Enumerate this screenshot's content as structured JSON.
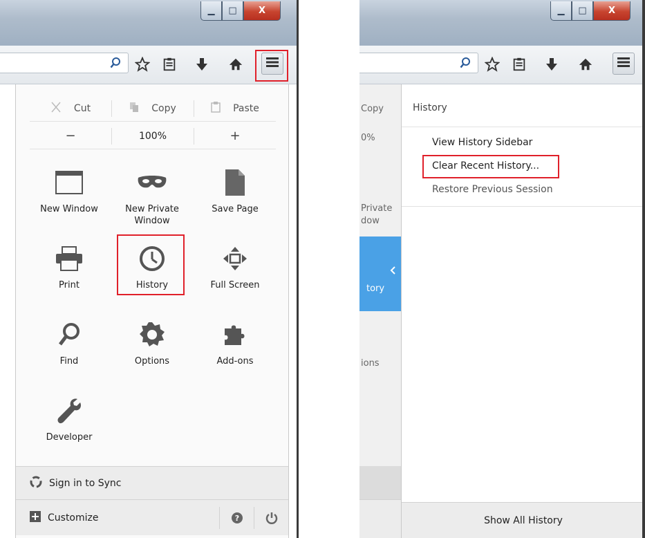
{
  "left_pane": {
    "edit": {
      "cut": "Cut",
      "copy": "Copy",
      "paste": "Paste"
    },
    "zoom": {
      "minus": "−",
      "level": "100%",
      "plus": "+"
    },
    "items": [
      {
        "label": "New Window",
        "icon": "window-icon"
      },
      {
        "label": "New Private\nWindow",
        "icon": "mask-icon"
      },
      {
        "label": "Save Page",
        "icon": "page-icon"
      },
      {
        "label": "Print",
        "icon": "printer-icon"
      },
      {
        "label": "History",
        "icon": "clock-icon"
      },
      {
        "label": "Full Screen",
        "icon": "fullscreen-icon"
      },
      {
        "label": "Find",
        "icon": "magnifier-icon"
      },
      {
        "label": "Options",
        "icon": "gear-icon"
      },
      {
        "label": "Add-ons",
        "icon": "puzzle-icon"
      },
      {
        "label": "Developer",
        "icon": "wrench-icon"
      }
    ],
    "sync": "Sign in to Sync",
    "customize": "Customize"
  },
  "right_pane": {
    "ghost": {
      "copy": "Copy",
      "zoom": "0%",
      "private1": "Private",
      "private2": "dow",
      "history": "tory",
      "options": "ions"
    },
    "history": {
      "title": "History",
      "view_sidebar": "View History Sidebar",
      "clear_recent": "Clear Recent History...",
      "restore": "Restore Previous Session",
      "show_all": "Show All History"
    }
  },
  "colors": {
    "highlight": "#e0202a",
    "accent": "#4aa1e6"
  }
}
